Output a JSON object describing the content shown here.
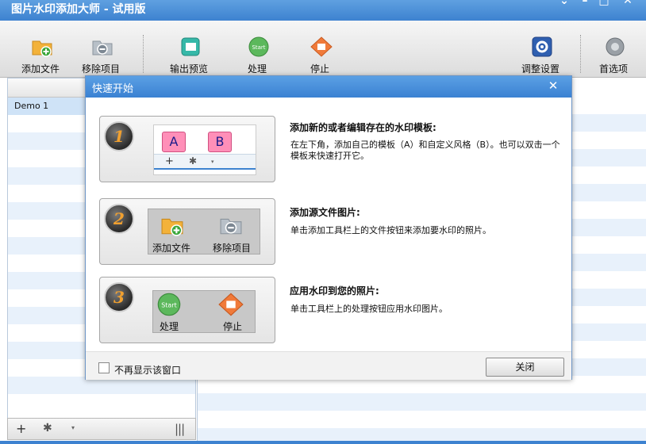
{
  "window": {
    "title": "图片水印添加大师 - 试用版",
    "controls": {
      "dropdown": "⌄",
      "minimize": "–",
      "maximize": "□",
      "close": "✕"
    }
  },
  "toolbar": {
    "add_files": "添加文件",
    "remove_items": "移除项目",
    "output_preview": "输出预览",
    "process": "处理",
    "stop": "停止",
    "adjust_settings": "调整设置",
    "preferences": "首选项"
  },
  "left_panel": {
    "items": [
      {
        "label": "Demo 1"
      }
    ],
    "bottom": {
      "add": "+",
      "settings": "✱",
      "caret": "▾",
      "grip": "|||"
    }
  },
  "dialog": {
    "title": "快速开始",
    "close_glyph": "✕",
    "steps": [
      {
        "number": "1",
        "title": "添加新的或者编辑存在的水印模板:",
        "description": "在左下角，添加自己的模板（A）和自定义风格（B）。也可以双击一个模板来快速打开它。",
        "tag_a": "A",
        "tag_b": "B",
        "plus": "+",
        "gear": "✱",
        "caret": "▾"
      },
      {
        "number": "2",
        "title": "添加源文件图片:",
        "description": "单击添加工具栏上的文件按钮来添加要水印的照片。",
        "add_label": "添加文件",
        "remove_label": "移除项目"
      },
      {
        "number": "3",
        "title": "应用水印到您的照片:",
        "description": "单击工具栏上的处理按钮应用水印图片。",
        "process_label": "处理",
        "stop_label": "停止",
        "start_text": "Start"
      }
    ],
    "dont_show": "不再显示该窗口",
    "close_button": "关闭"
  },
  "colors": {
    "titlebar": "#3d82d0",
    "dialog_border": "#6d95c6",
    "stripe": "#e8f1fb",
    "step_number": "#f0a030"
  },
  "icons": [
    "folder-add-icon",
    "folder-remove-icon",
    "preview-icon",
    "start-icon",
    "stop-icon",
    "gear-icon",
    "preferences-icon",
    "close-icon"
  ]
}
